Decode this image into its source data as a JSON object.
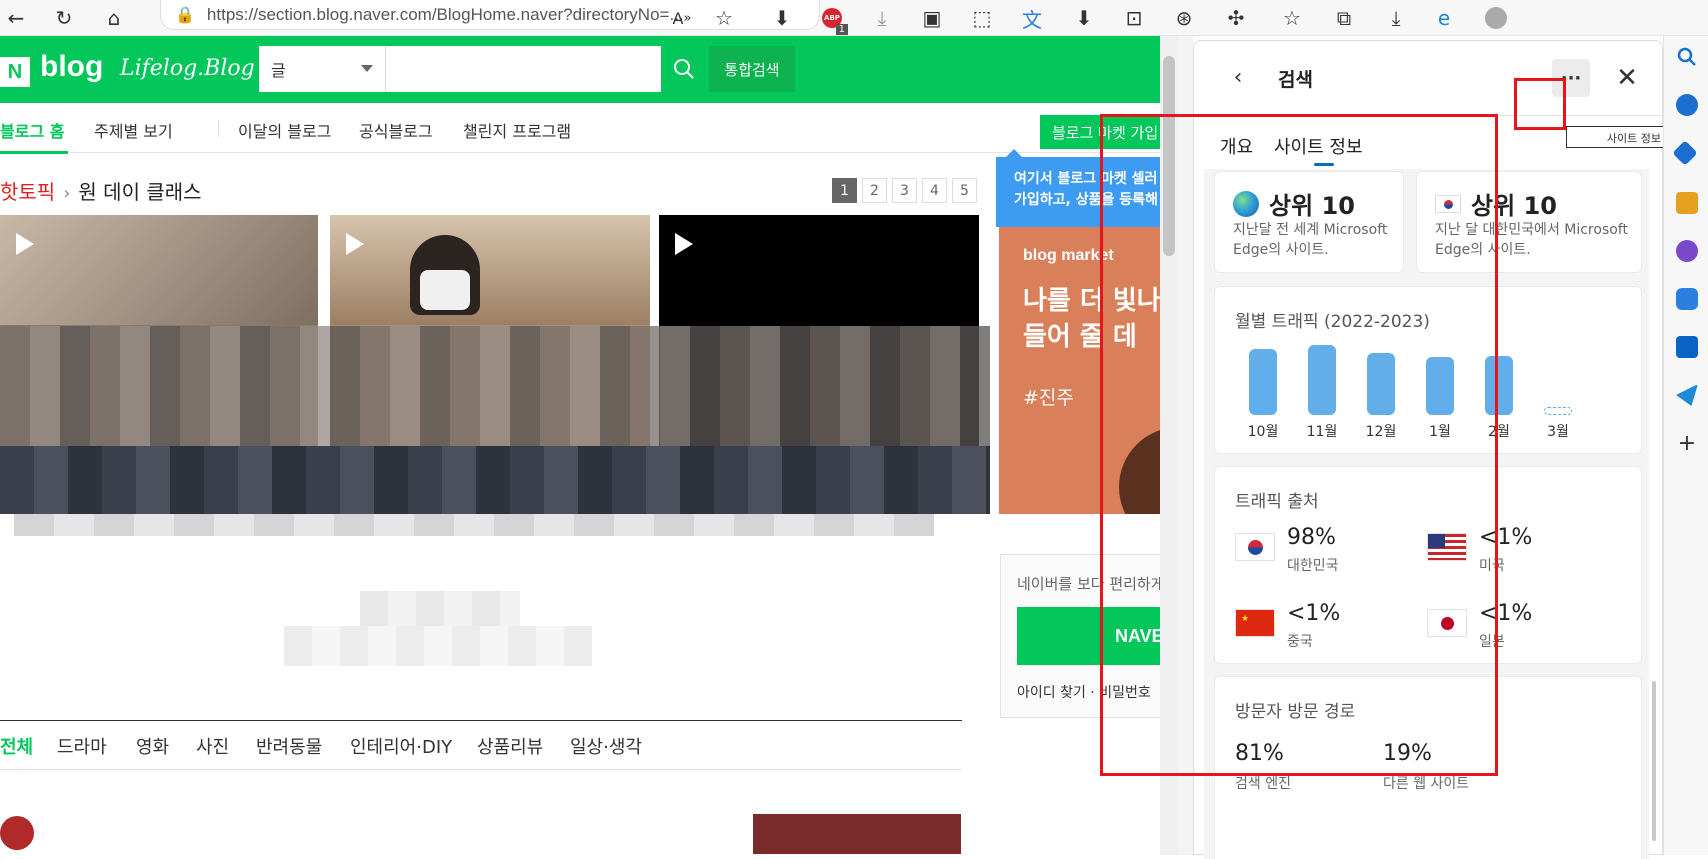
{
  "browser": {
    "url": "https://section.blog.naver.com/BlogHome.naver?directoryNo=...",
    "abp_badge": "1"
  },
  "naver": {
    "logo_n": "N",
    "logo_blog": "blog",
    "lifelog": "Lifelog.Blog",
    "search_select": "글",
    "search_placeholder": "",
    "total_search": "통합검색",
    "nav": [
      "블로그 홈",
      "주제별 보기",
      "이달의 블로그",
      "공식블로그",
      "챌린지 프로그램"
    ],
    "market_button": "블로그 마켓 가입",
    "hot_label": "핫토픽",
    "hot_topic": "원 데이 클래스",
    "pages": [
      "1",
      "2",
      "3",
      "4",
      "5"
    ],
    "tooltip": "여기서 블로그 마켓 셀러 가입하고, 상품을 등록해",
    "ad_brand": "blog market",
    "ad_headline": "나를 더 빛나게 만들어 줄 데",
    "ad_tag": "#진주",
    "login_desc": "네이버를 보다 편리하게",
    "login_button": "NAVER",
    "login_links": "아이디 찾기 · 비밀번호",
    "categories": [
      "전체",
      "드라마",
      "영화",
      "사진",
      "반려동물",
      "인테리어·DIY",
      "상품리뷰",
      "일상·생각"
    ]
  },
  "panel": {
    "title": "검색",
    "tabs": [
      "개요",
      "사이트 정보"
    ],
    "tooltip_partial": "사이트 정보",
    "rank_global": {
      "label": "상위 10",
      "desc": "지난달 전 세계 Microsoft Edge의 사이트."
    },
    "rank_korea": {
      "label": "상위 10",
      "desc": "지난 달 대한민국에서 Microsoft Edge의 사이트."
    },
    "traffic_title": "월별 트래픽 (2022-2023)",
    "traffic": [
      {
        "month": "10월",
        "value": 0.84
      },
      {
        "month": "11월",
        "value": 0.9
      },
      {
        "month": "12월",
        "value": 0.8
      },
      {
        "month": "1월",
        "value": 0.74
      },
      {
        "month": "2월",
        "value": 0.76
      },
      {
        "month": "3월",
        "value": 0.1
      }
    ],
    "sources_title": "트래픽 출처",
    "sources": [
      {
        "pct": "98%",
        "name": "대한민국",
        "flag": "kr"
      },
      {
        "pct": "<1%",
        "name": "미국",
        "flag": "us"
      },
      {
        "pct": "<1%",
        "name": "중국",
        "flag": "cn"
      },
      {
        "pct": "<1%",
        "name": "일본",
        "flag": "jp"
      }
    ],
    "visit_title": "방문자 방문 경로",
    "visit": [
      {
        "pct": "81%",
        "name": "검색 엔진"
      },
      {
        "pct": "19%",
        "name": "다른 웹 사이트"
      }
    ]
  },
  "colors": {
    "naver_green": "#03c75a",
    "bar_blue": "#62aeea",
    "highlight_red": "#e8141c"
  }
}
